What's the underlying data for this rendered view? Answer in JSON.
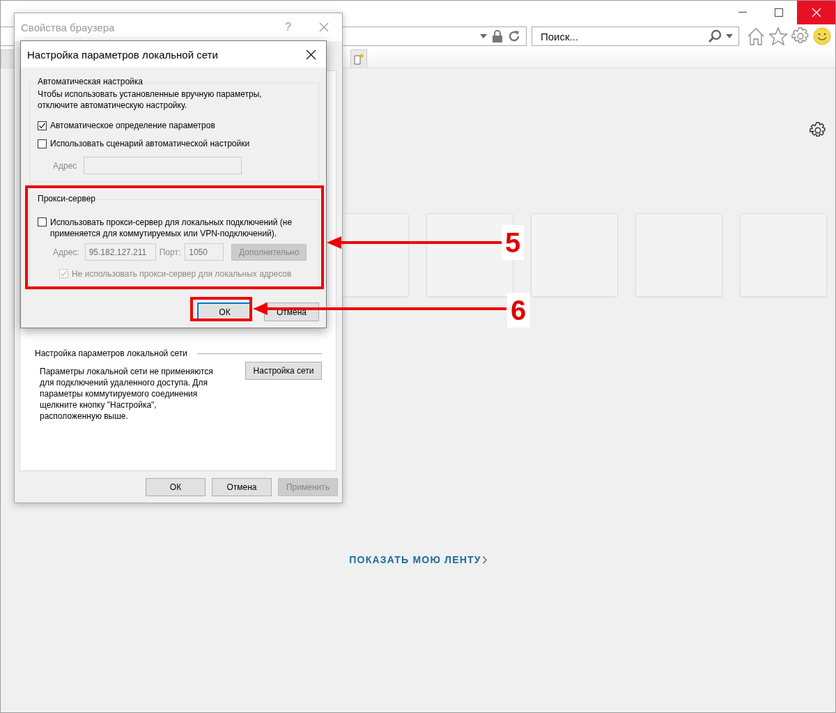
{
  "browser": {
    "search": {
      "placeholder": "Поиск..."
    },
    "feed_link": "ПОКАЗАТЬ МОЮ ЛЕНТУ"
  },
  "properties_dialog": {
    "title": "Свойства браузера",
    "help": "?",
    "lan_section": {
      "title": "Настройка параметров локальной сети",
      "text": "Параметры локальной сети не применяются для подключений удаленного доступа. Для параметры коммутируемого соединения щелкните кнопку \"Настройка\", расположенную выше.",
      "button": "Настройка сети"
    },
    "buttons": [
      {
        "label": "ОК",
        "disabled": false
      },
      {
        "label": "Отмена",
        "disabled": false
      },
      {
        "label": "Применить",
        "disabled": true
      }
    ]
  },
  "lan_dialog": {
    "title": "Настройка параметров локальной сети",
    "auto_group": {
      "title": "Автоматическая настройка",
      "hint": "Чтобы использовать установленные вручную параметры, отключите автоматическую настройку.",
      "options": [
        {
          "label": "Автоматическое определение параметров",
          "checked": true,
          "disabled": false
        },
        {
          "label": "Использовать сценарий автоматической настройки",
          "checked": false,
          "disabled": false
        }
      ],
      "address": {
        "label": "Адрес",
        "disabled": true
      }
    },
    "proxy_group": {
      "title": "Прокси-сервер",
      "use_proxy": {
        "label": "Использовать прокси-сервер для локальных подключений (не применяется для коммутируемых или VPN-подключений).",
        "checked": false,
        "disabled": false
      },
      "address_label": "Адрес:",
      "address": "95.182.127.211",
      "port_label": "Порт:",
      "port": "1050",
      "advanced_button": {
        "label": "Дополнительно",
        "disabled": true
      },
      "bypass_local": {
        "label": "Не использовать прокси-сервер для локальных адресов",
        "checked": true,
        "disabled": true
      }
    },
    "buttons": [
      {
        "label": "ОК",
        "default": true
      },
      {
        "label": "Отмена",
        "default": false
      }
    ]
  },
  "annotations": [
    {
      "number": "5"
    },
    {
      "number": "6"
    }
  ]
}
